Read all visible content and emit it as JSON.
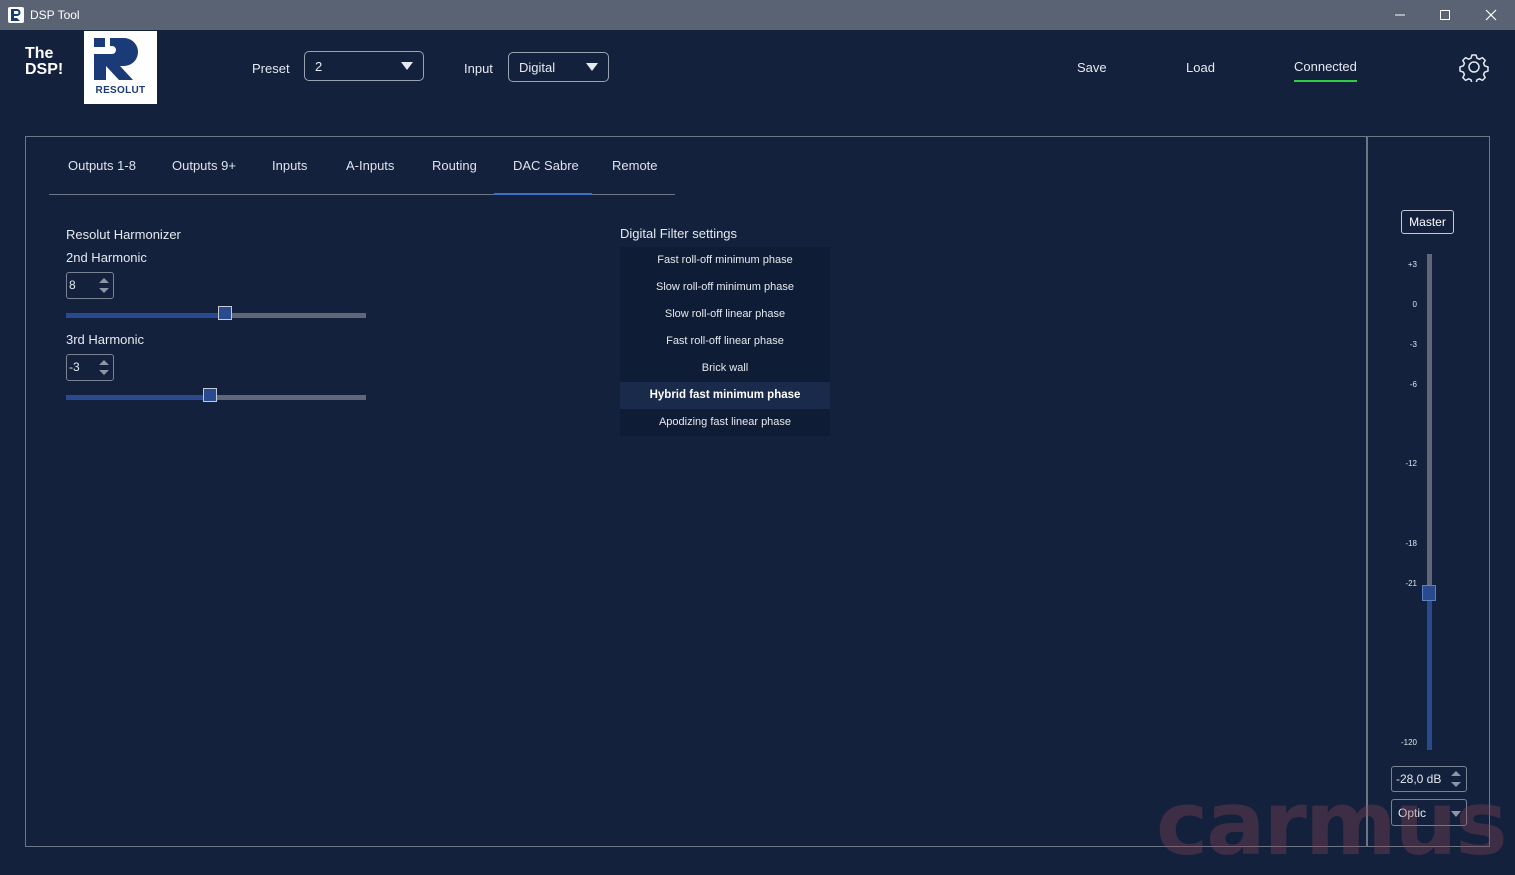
{
  "window": {
    "title": "DSP Tool"
  },
  "header": {
    "logo_line1": "The",
    "logo_line2": "DSP!",
    "brand": "RESOLUT",
    "preset_label": "Preset",
    "preset_value": "2",
    "input_label": "Input",
    "input_value": "Digital",
    "save": "Save",
    "load": "Load",
    "status": "Connected",
    "status_color": "#2ecc40"
  },
  "tabs": [
    "Outputs 1-8",
    "Outputs 9+",
    "Inputs",
    "A-Inputs",
    "Routing",
    "DAC Sabre",
    "Remote"
  ],
  "active_tab": "DAC Sabre",
  "harmonizer": {
    "title": "Resolut Harmonizer",
    "h2_label": "2nd Harmonic",
    "h2_value": "8",
    "h2_slider_fraction": 0.53,
    "h3_label": "3rd Harmonic",
    "h3_value": "-3",
    "h3_slider_fraction": 0.48
  },
  "filter": {
    "title": "Digital Filter settings",
    "items": [
      "Fast roll-off minimum phase",
      "Slow roll-off minimum phase",
      "Slow roll-off linear phase",
      "Fast roll-off linear phase",
      "Brick  wall",
      "Hybrid fast minimum phase",
      "Apodizing fast linear phase"
    ],
    "selected": "Hybrid fast minimum phase"
  },
  "master": {
    "button": "Master",
    "scale": [
      "+3",
      "0",
      "-3",
      "-6",
      "-12",
      "-18",
      "-21",
      "-120"
    ],
    "value": "-28,0 dB",
    "source": "Optic"
  },
  "watermark": "carmus",
  "colors": {
    "accent": "#2a4a8f",
    "background": "#13213d"
  },
  "icons": {
    "settings": "gear-icon"
  }
}
